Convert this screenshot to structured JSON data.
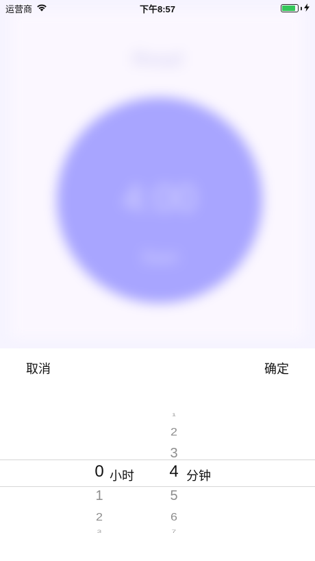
{
  "status_bar": {
    "carrier": "运营商",
    "time": "下午8:57",
    "battery_level": 0.85,
    "wifi_icon": "wifi-icon",
    "charging_icon": "bolt-icon"
  },
  "background_app": {
    "title": "Read",
    "timer": "4:00",
    "start_label": "Start",
    "circle_color": "#a8a5ff"
  },
  "picker_sheet": {
    "cancel_label": "取消",
    "confirm_label": "确定",
    "hours": {
      "selected": "0",
      "unit": "小时",
      "below": [
        "1",
        "2",
        "3"
      ]
    },
    "minutes": {
      "above": [
        "1",
        "2",
        "3"
      ],
      "selected": "4",
      "unit": "分钟",
      "below": [
        "5",
        "6",
        "7"
      ]
    }
  }
}
